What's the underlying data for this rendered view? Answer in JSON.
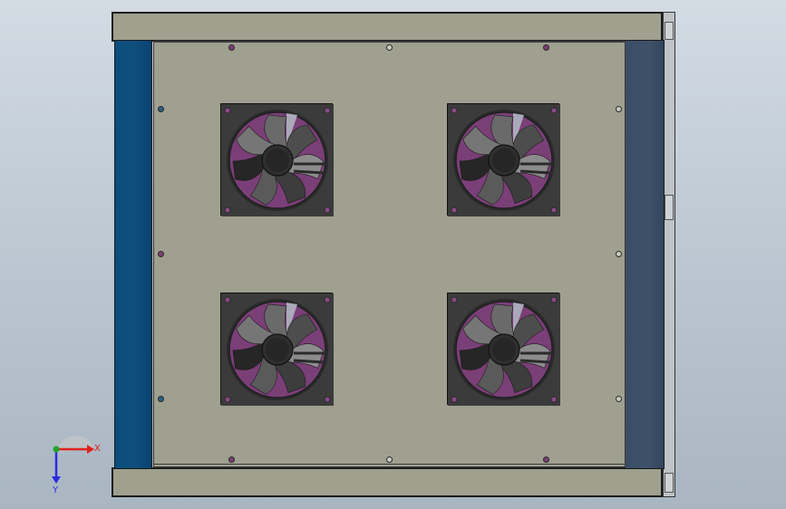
{
  "viewport": {
    "background_top": "#d3dbe3",
    "background_bottom": "#a9b6c2"
  },
  "model": {
    "frame_color": "#9fa08e",
    "left_panel_color": "#0b4d7c",
    "right_panel_color": "#3b4e66",
    "plate_color": "#9fa090",
    "fan_frame_color": "#3a3a3a",
    "fan_impeller_color": "#7b3f78",
    "fans": [
      "fan-top-left",
      "fan-top-right",
      "fan-bottom-left",
      "fan-bottom-right"
    ]
  },
  "triad": {
    "x_label": "X",
    "y_label": "Y",
    "x_color": "#e0201c",
    "y_color": "#2a2ae0"
  }
}
